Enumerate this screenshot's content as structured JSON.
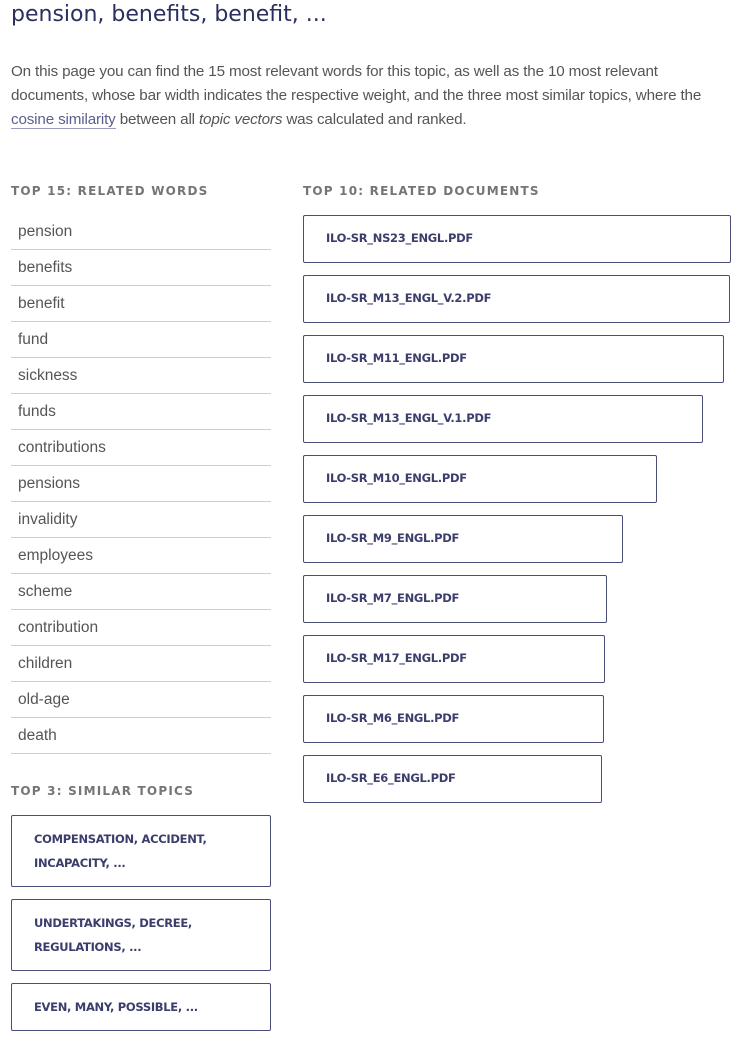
{
  "page": {
    "title": "pension, benefits, benefit, ...",
    "intro": {
      "part1": "On this page you can find the 15 most relevant words for this topic, as well as the 10 most relevant documents, whose bar width indicates the respective weight, and the three most similar topics, where the ",
      "link": "cosine similarity",
      "part2": " between all ",
      "emphasis": "topic vectors",
      "part3": " was calculated and ranked."
    }
  },
  "words": {
    "heading": "TOP 15: RELATED WORDS",
    "items": [
      "pension",
      "benefits",
      "benefit",
      "fund",
      "sickness",
      "funds",
      "contributions",
      "pensions",
      "invalidity",
      "employees",
      "scheme",
      "contribution",
      "children",
      "old-age",
      "death"
    ]
  },
  "documents": {
    "heading": "TOP 10: RELATED DOCUMENTS",
    "items": [
      {
        "label": "ILO-SR_NS23_ENGL.PDF",
        "weight": 1.0
      },
      {
        "label": "ILO-SR_M13_ENGL_V.2.PDF",
        "weight": 0.998
      },
      {
        "label": "ILO-SR_M11_ENGL.PDF",
        "weight": 0.984
      },
      {
        "label": "ILO-SR_M13_ENGL_V.1.PDF",
        "weight": 0.934
      },
      {
        "label": "ILO-SR_M10_ENGL.PDF",
        "weight": 0.827
      },
      {
        "label": "ILO-SR_M9_ENGL.PDF",
        "weight": 0.747
      },
      {
        "label": "ILO-SR_M7_ENGL.PDF",
        "weight": 0.71
      },
      {
        "label": "ILO-SR_M17_ENGL.PDF",
        "weight": 0.705
      },
      {
        "label": "ILO-SR_M6_ENGL.PDF",
        "weight": 0.703
      },
      {
        "label": "ILO-SR_E6_ENGL.PDF",
        "weight": 0.698
      }
    ]
  },
  "topics": {
    "heading": "TOP 3: SIMILAR TOPICS",
    "items": [
      "COMPENSATION, ACCIDENT, INCAPACITY, ...",
      "UNDERTAKINGS, DECREE, REGULATIONS, ...",
      "EVEN, MANY, POSSIBLE, ..."
    ]
  },
  "colors": {
    "accent": "#3b3e6b",
    "border": "#4a4d78",
    "text": "#555555",
    "label": "#757575"
  }
}
